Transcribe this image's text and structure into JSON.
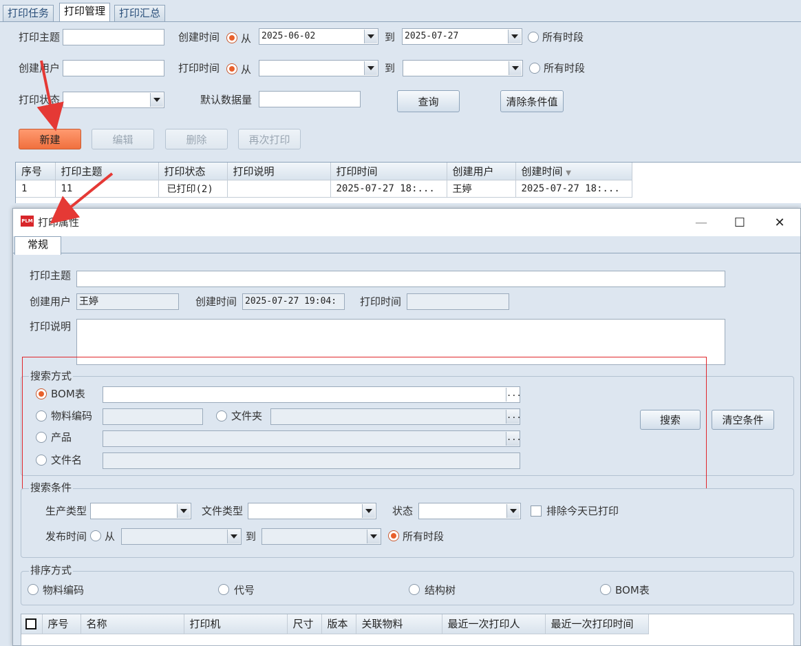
{
  "top_tabs": [
    "打印任务",
    "打印管理",
    "打印汇总"
  ],
  "filters": {
    "print_subject_label": "打印主题",
    "create_user_label": "创建用户",
    "print_status_label": "打印状态",
    "create_time_label": "创建时间",
    "print_time_label": "打印时间",
    "from_label": "从",
    "to_label": "到",
    "all_time_label": "所有时段",
    "create_from": "2025-06-02",
    "create_to": "2025-07-27",
    "default_count_label": "默认数据量",
    "query_btn": "查询",
    "clear_btn": "清除条件值"
  },
  "actions": {
    "new": "新建",
    "edit": "编辑",
    "delete": "删除",
    "reprint": "再次打印"
  },
  "main_table": {
    "columns": [
      "序号",
      "打印主题",
      "打印状态",
      "打印说明",
      "打印时间",
      "创建用户",
      "创建时间"
    ],
    "rows": [
      [
        "1",
        "11",
        "已打印(2)",
        "",
        "2025-07-27 18:...",
        "王婷",
        "2025-07-27 18:..."
      ]
    ]
  },
  "dialog": {
    "logo_text": "PLM",
    "title": "打印属性",
    "minimize": "—",
    "maximize": "☐",
    "close": "✕",
    "tab": "常规",
    "subject_label": "打印主题",
    "create_user_label": "创建用户",
    "create_user": "王婷",
    "create_time_label": "创建时间",
    "create_time": "2025-07-27 19:04:",
    "print_time_label": "打印时间",
    "desc_label": "打印说明",
    "search_mode": {
      "title": "搜索方式",
      "bom": "BOM表",
      "material_code": "物料编码",
      "folder": "文件夹",
      "product": "产品",
      "file_name": "文件名",
      "ellipsis": "...",
      "search_btn": "搜索",
      "clear_btn": "清空条件"
    },
    "search_cond": {
      "title": "搜索条件",
      "prod_type": "生产类型",
      "file_type": "文件类型",
      "status": "状态",
      "exclude_today": "排除今天已打印",
      "publish_time": "发布时间",
      "from": "从",
      "to": "到",
      "all_time": "所有时段"
    },
    "sort": {
      "title": "排序方式",
      "material_code": "物料编码",
      "code": "代号",
      "tree": "结构树",
      "bom": "BOM表"
    },
    "table_columns": [
      "序号",
      "名称",
      "打印机",
      "尺寸",
      "版本",
      "关联物料",
      "最近一次打印人",
      "最近一次打印时间"
    ]
  },
  "colors": {
    "accent": "#f0703e",
    "highlight_box": "#e0252a",
    "arrow": "#e53935"
  }
}
